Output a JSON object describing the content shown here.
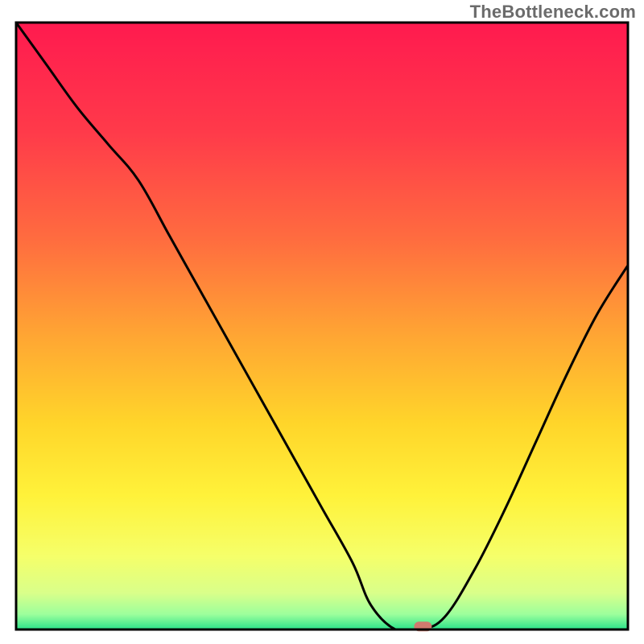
{
  "watermark": "TheBottleneck.com",
  "chart_data": {
    "type": "line",
    "title": "",
    "xlabel": "",
    "ylabel": "",
    "x": [
      0.0,
      0.05,
      0.1,
      0.15,
      0.2,
      0.25,
      0.3,
      0.35,
      0.4,
      0.45,
      0.5,
      0.55,
      0.58,
      0.62,
      0.66,
      0.7,
      0.75,
      0.8,
      0.85,
      0.9,
      0.95,
      1.0
    ],
    "values": [
      1.0,
      0.93,
      0.86,
      0.8,
      0.74,
      0.65,
      0.56,
      0.47,
      0.38,
      0.29,
      0.2,
      0.11,
      0.04,
      0.0,
      0.0,
      0.02,
      0.1,
      0.2,
      0.31,
      0.42,
      0.52,
      0.6
    ],
    "xlim": [
      0,
      1
    ],
    "ylim": [
      0,
      1
    ],
    "marker": {
      "x": 0.665,
      "y": 0.005,
      "color": "#cf7a6e"
    },
    "gradient_stops": [
      {
        "offset": 0.0,
        "color": "#ff1a4f"
      },
      {
        "offset": 0.18,
        "color": "#ff3a4a"
      },
      {
        "offset": 0.36,
        "color": "#ff6d3f"
      },
      {
        "offset": 0.52,
        "color": "#ffa733"
      },
      {
        "offset": 0.66,
        "color": "#ffd52a"
      },
      {
        "offset": 0.78,
        "color": "#fff23a"
      },
      {
        "offset": 0.88,
        "color": "#f5ff6a"
      },
      {
        "offset": 0.94,
        "color": "#d9ff8a"
      },
      {
        "offset": 0.975,
        "color": "#9cff9c"
      },
      {
        "offset": 1.0,
        "color": "#2ae28a"
      }
    ],
    "frame_color": "#000000",
    "line_color": "#000000"
  }
}
